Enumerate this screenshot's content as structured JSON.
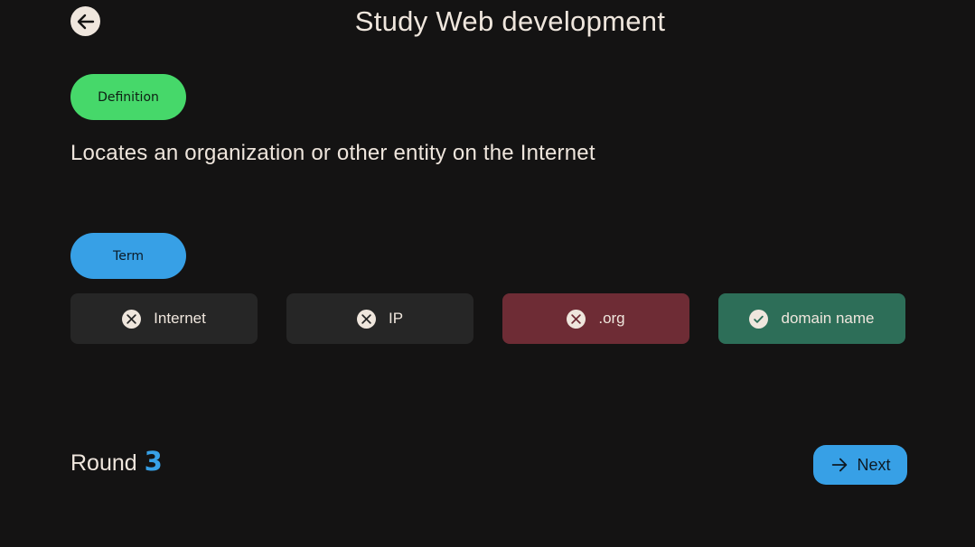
{
  "header": {
    "title": "Study Web development",
    "back_icon": "arrow-left-icon"
  },
  "definition": {
    "label": "Definition",
    "text": "Locates an organization or other entity on the Internet"
  },
  "term": {
    "label": "Term"
  },
  "options": [
    {
      "label": "Internet",
      "state": "neutral",
      "icon": "close-circle-icon"
    },
    {
      "label": "IP",
      "state": "neutral",
      "icon": "close-circle-icon"
    },
    {
      "label": ".org",
      "state": "wrong",
      "icon": "close-circle-icon"
    },
    {
      "label": "domain name",
      "state": "correct",
      "icon": "check-circle-icon"
    }
  ],
  "round": {
    "label": "Round",
    "number": "3"
  },
  "next": {
    "label": "Next",
    "icon": "arrow-right-icon"
  },
  "colors": {
    "background": "#141313",
    "definition_pill": "#46d86a",
    "term_pill": "#37a0e6",
    "wrong": "#6e2c35",
    "correct": "#2d6e58",
    "accent": "#37a0e6"
  }
}
